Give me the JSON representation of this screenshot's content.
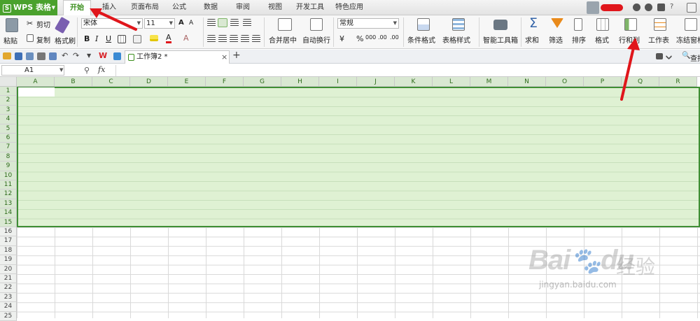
{
  "app": {
    "name": "WPS 表格",
    "logo": "S"
  },
  "menu": {
    "tabs": [
      "开始",
      "插入",
      "页面布局",
      "公式",
      "数据",
      "审阅",
      "视图",
      "开发工具",
      "特色应用"
    ],
    "active": "开始"
  },
  "ribbon": {
    "paste": "粘贴",
    "cut": "剪切",
    "copy": "复制",
    "format_painter": "格式刷",
    "font_name": "宋体",
    "font_size": "11",
    "bold": "B",
    "italic": "I",
    "underline": "U",
    "grow_font": "A",
    "shrink_font": "A",
    "merge_center": "合并居中",
    "wrap_text": "自动换行",
    "number_format": "常规",
    "currency": "¥",
    "percent": "%",
    "comma": "000",
    "inc_decimal": ".00",
    "dec_decimal": ".00",
    "conditional_format": "条件格式",
    "table_style": "表格样式",
    "smart_toolbox": "智能工具箱",
    "sum": "求和",
    "filter": "筛选",
    "sort": "排序",
    "format": "格式",
    "rows_cols": "行和列",
    "worksheet": "工作表",
    "freeze": "冻结窗格"
  },
  "quickbar": {
    "doc_tab": "工作簿2 *",
    "add_tab": "+",
    "search": "查找"
  },
  "formula_bar": {
    "cell_ref": "A1",
    "fx": "fx"
  },
  "sheet": {
    "columns": [
      "A",
      "B",
      "C",
      "D",
      "E",
      "F",
      "G",
      "H",
      "I",
      "J",
      "K",
      "L",
      "M",
      "N",
      "O",
      "P",
      "Q",
      "R"
    ],
    "rows": [
      "1",
      "2",
      "3",
      "4",
      "5",
      "6",
      "7",
      "8",
      "9",
      "10",
      "11",
      "12",
      "13",
      "14",
      "15",
      "16",
      "17",
      "18",
      "19",
      "20",
      "21",
      "22",
      "23",
      "24",
      "25"
    ],
    "selected_rows": 15
  },
  "watermark": {
    "brand": "Bai",
    "paw": "du",
    "cn": "经验",
    "url": "jingyan.baidu.com"
  },
  "colors": {
    "accent": "#4aa12d",
    "selection": "#dff1d3",
    "selection_border": "#3f8f34",
    "arrow": "#e0161b"
  }
}
